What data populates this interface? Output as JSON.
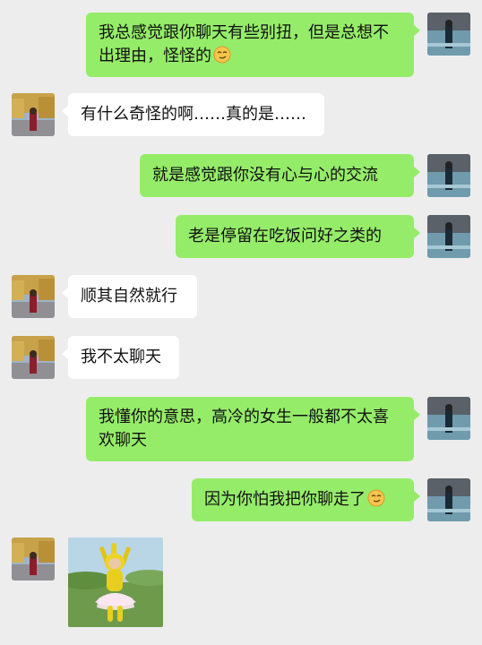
{
  "messages": [
    {
      "sender": "me",
      "text": "我总感觉跟你聊天有些别扭，但是总想不出理由，怪怪的",
      "emoji": "smirk-face-emoji"
    },
    {
      "sender": "her",
      "text": "有什么奇怪的啊……真的是……"
    },
    {
      "sender": "me",
      "text": "就是感觉跟你没有心与心的交流"
    },
    {
      "sender": "me",
      "text": "老是停留在吃饭问好之类的"
    },
    {
      "sender": "her",
      "text": "顺其自然就行"
    },
    {
      "sender": "her",
      "text": "我不太聊天"
    },
    {
      "sender": "me",
      "text": "我懂你的意思，高冷的女生一般都不太喜欢聊天"
    },
    {
      "sender": "me",
      "text": "因为你怕我把你聊走了",
      "emoji": "smirk-face-emoji"
    },
    {
      "sender": "her",
      "type": "sticker",
      "sticker": "teletubby-dancing-sticker"
    }
  ],
  "colors": {
    "background": "#ededed",
    "my_bubble": "#95ec69",
    "her_bubble": "#ffffff"
  }
}
